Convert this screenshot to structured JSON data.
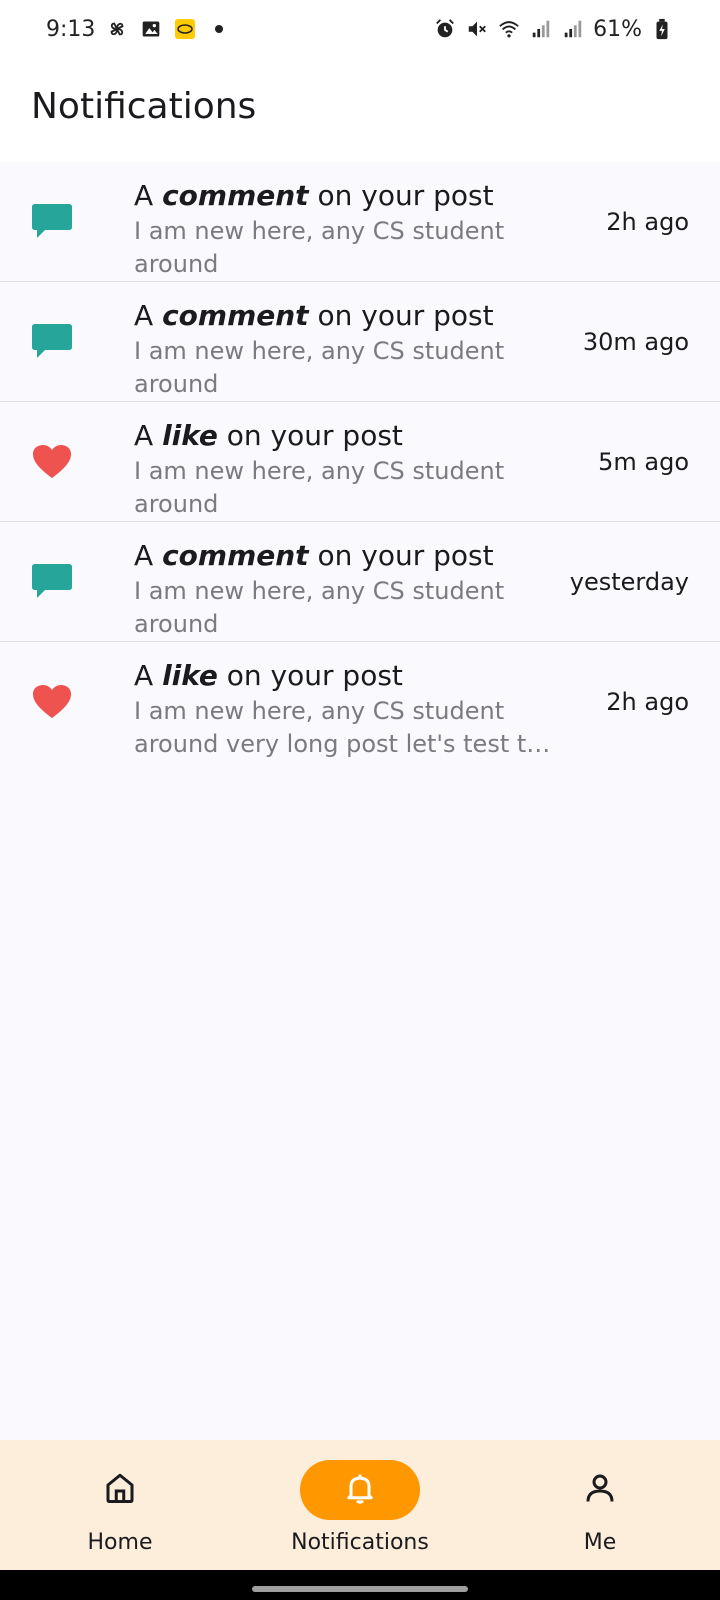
{
  "status_bar": {
    "time": "9:13",
    "battery": "61%",
    "left_icons": [
      "pinwheel-icon",
      "gallery-icon",
      "mtn-icon",
      "dot-icon"
    ],
    "right_icons": [
      "alarm-icon",
      "mute-icon",
      "wifi-icon",
      "signal-icon",
      "signal-icon",
      "battery-icon"
    ]
  },
  "app_bar": {
    "title": "Notifications"
  },
  "notifications": [
    {
      "type": "comment",
      "prefix": "A",
      "kind": "comment",
      "suffix": "on your post",
      "body": "I am new here, any CS student around",
      "time": "2h ago"
    },
    {
      "type": "comment",
      "prefix": "A",
      "kind": "comment",
      "suffix": "on your post",
      "body": "I am new here, any CS student around",
      "time": "30m ago"
    },
    {
      "type": "like",
      "prefix": "A",
      "kind": "like",
      "suffix": "on your post",
      "body": "I am new here, any CS student around",
      "time": "5m ago"
    },
    {
      "type": "comment",
      "prefix": "A",
      "kind": "comment",
      "suffix": "on your post",
      "body": "I am new here, any CS student around",
      "time": "yesterday"
    },
    {
      "type": "like",
      "prefix": "A",
      "kind": "like",
      "suffix": "on your post",
      "body": "I am new here, any CS student around very long post let's test the ...",
      "time": "2h ago"
    }
  ],
  "bottom_nav": {
    "items": [
      {
        "label": "Home",
        "icon": "home-icon",
        "active": false
      },
      {
        "label": "Notifications",
        "icon": "bell-icon",
        "active": true
      },
      {
        "label": "Me",
        "icon": "person-icon",
        "active": false
      }
    ]
  },
  "colors": {
    "comment_icon": "#26a69a",
    "like_icon": "#ef5350",
    "nav_active": "#ff9800",
    "nav_background": "#fdeedb",
    "list_background": "#f9f9fe"
  }
}
